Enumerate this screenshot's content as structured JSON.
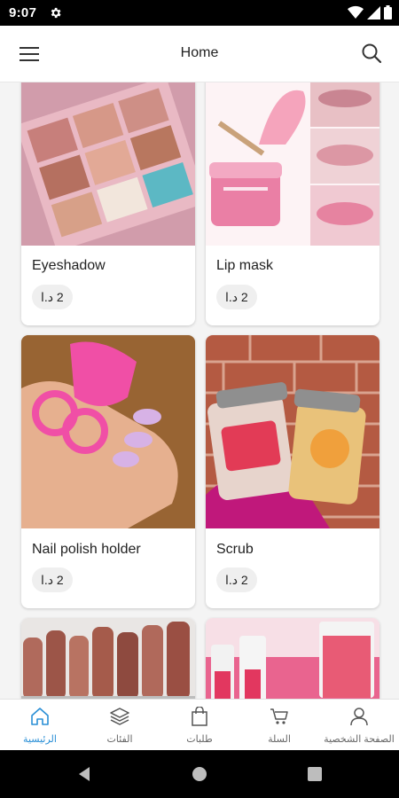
{
  "status_bar": {
    "time": "9:07"
  },
  "header": {
    "title": "Home"
  },
  "products": [
    {
      "name": "Eyeshadow",
      "price": "2 د.ا"
    },
    {
      "name": "Lip mask",
      "price": "2 د.ا"
    },
    {
      "name": "Nail polish holder",
      "price": "2 د.ا"
    },
    {
      "name": "Scrub",
      "price": "2 د.ا"
    }
  ],
  "bottom_nav": {
    "items": [
      {
        "label": "الصفحة الشخصية",
        "icon": "user-icon"
      },
      {
        "label": "السلة",
        "icon": "cart-icon"
      },
      {
        "label": "طلبات",
        "icon": "bag-icon"
      },
      {
        "label": "الفئات",
        "icon": "layers-icon"
      },
      {
        "label": "الرئيسية",
        "icon": "home-icon",
        "active": true
      }
    ]
  },
  "colors": {
    "accent": "#2a8fd6",
    "background": "#f4f4f4"
  }
}
